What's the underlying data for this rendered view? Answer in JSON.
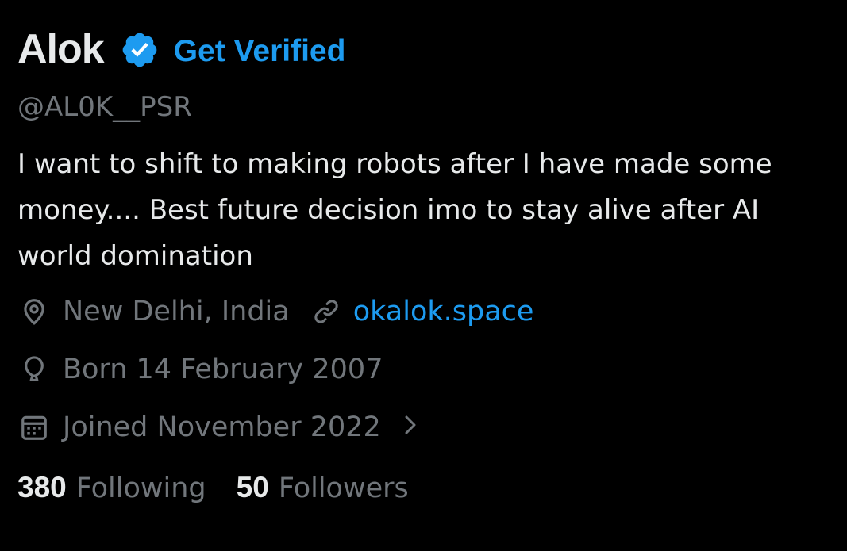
{
  "profile": {
    "display_name": "Alok",
    "get_verified_label": "Get Verified",
    "handle": "@AL0K__PSR",
    "bio": "I want to shift to making robots after I have made some money.... Best future decision imo to stay alive after AI world domination"
  },
  "meta": {
    "location": "New Delhi, India",
    "website": "okalok.space",
    "birthday": "Born 14 February 2007",
    "joined": "Joined November 2022"
  },
  "stats": {
    "following_count": "380",
    "following_label": "Following",
    "followers_count": "50",
    "followers_label": "Followers"
  },
  "icons": {
    "verified": "verified-badge-icon",
    "location": "location-pin-icon",
    "link": "link-icon",
    "birthday": "balloon-icon",
    "joined": "calendar-icon",
    "chevron": "chevron-right-icon"
  },
  "colors": {
    "background": "#000000",
    "primary_text": "#e7e9ea",
    "secondary_text": "#71767b",
    "accent": "#1d9bf0"
  }
}
